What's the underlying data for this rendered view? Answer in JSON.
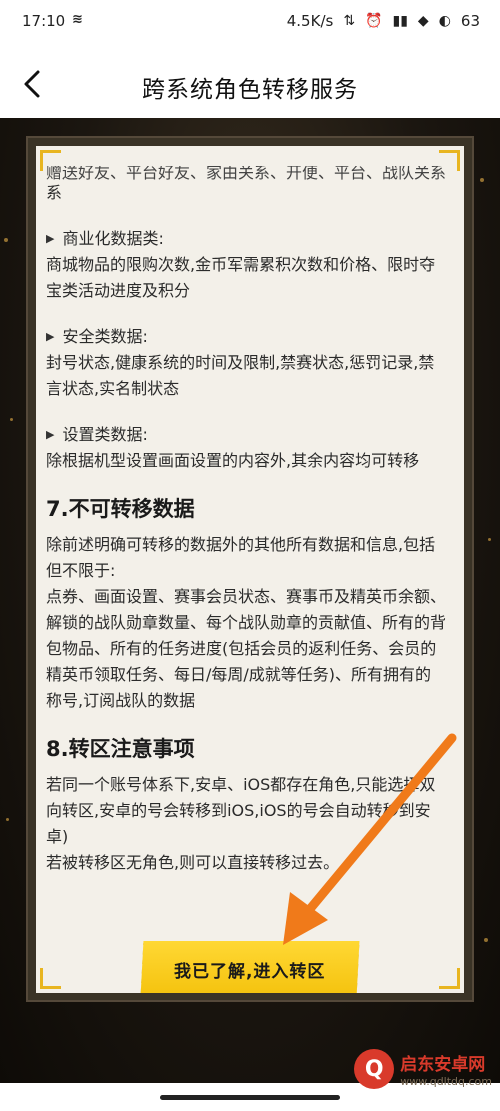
{
  "status_bar": {
    "time": "17:10",
    "network_speed": "4.5K/s",
    "battery": "63"
  },
  "header": {
    "title": "跨系统角色转移服务"
  },
  "content": {
    "cut_line": "赠送好友、平台好友、家由关系、开便、平台、战队关系",
    "cut_line_end": "系",
    "commercial": {
      "title": "商业化数据类:",
      "body": "商城物品的限购次数,金币军需累积次数和价格、限时夺宝类活动进度及积分"
    },
    "security": {
      "title": "安全类数据:",
      "body": "封号状态,健康系统的时间及限制,禁赛状态,惩罚记录,禁言状态,实名制状态"
    },
    "settings": {
      "title": "设置类数据:",
      "body": "除根据机型设置画面设置的内容外,其余内容均可转移"
    },
    "section7": {
      "heading": "7.不可转移数据",
      "intro": "除前述明确可转移的数据外的其他所有数据和信息,包括但不限于:",
      "body": "点券、画面设置、赛事会员状态、赛事币及精英币余额、解锁的战队勋章数量、每个战队勋章的贡献值、所有的背包物品、所有的任务进度(包括会员的返利任务、会员的精英币领取任务、每日/每周/成就等任务)、所有拥有的称号,订阅战队的数据"
    },
    "section8": {
      "heading": "8.转区注意事项",
      "body1": "若同一个账号体系下,安卓、iOS都存在角色,只能选择双向转区,安卓的号会转移到iOS,iOS的号会自动转移到安卓)",
      "body2": "若被转移区无角色,则可以直接转移过去。"
    }
  },
  "cta": {
    "label": "我已了解,进入转区"
  },
  "watermark": {
    "name": "启东安卓网",
    "url": "www.qdltdq.com"
  },
  "colors": {
    "accent_yellow": "#f4c20d",
    "arrow_orange": "#f07a1a",
    "panel_bg": "#f3f0e9"
  }
}
